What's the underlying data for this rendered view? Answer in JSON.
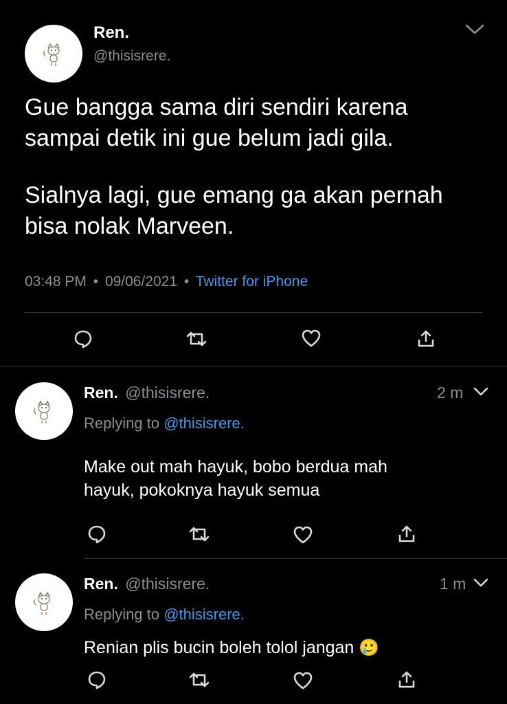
{
  "main_tweet": {
    "display_name": "Ren.",
    "handle": "@thisisrere.",
    "text_lines": [
      "Gue bangga sama diri sendiri karena",
      "sampai detik ini gue belum jadi gila.",
      "",
      "Sialnya lagi, gue emang ga akan pernah",
      "bisa nolak Marveen."
    ],
    "time": "03:48 PM",
    "date": "09/06/2021",
    "separator": "•",
    "source": "Twitter for iPhone"
  },
  "replies": [
    {
      "display_name": "Ren.",
      "handle": "@thisisrere.",
      "time_ago": "2 m",
      "replying_prefix": "Replying to",
      "replying_to": "@thisisrere.",
      "text_lines": [
        "Make out mah hayuk, bobo berdua mah",
        "hayuk, pokoknya hayuk semua"
      ]
    },
    {
      "display_name": "Ren.",
      "handle": "@thisisrere.",
      "time_ago": "1 m",
      "replying_prefix": "Replying to",
      "replying_to": "@thisisrere.",
      "text": "Renian plis bucin boleh tolol jangan",
      "emoji": "🥲"
    }
  ],
  "icons": [
    "chevron-down-icon",
    "reply-icon",
    "retweet-icon",
    "like-icon",
    "share-icon"
  ],
  "colors": {
    "background": "#000000",
    "link": "#3d9bea",
    "muted": "#8b8d90",
    "divider": "#2f3336"
  }
}
